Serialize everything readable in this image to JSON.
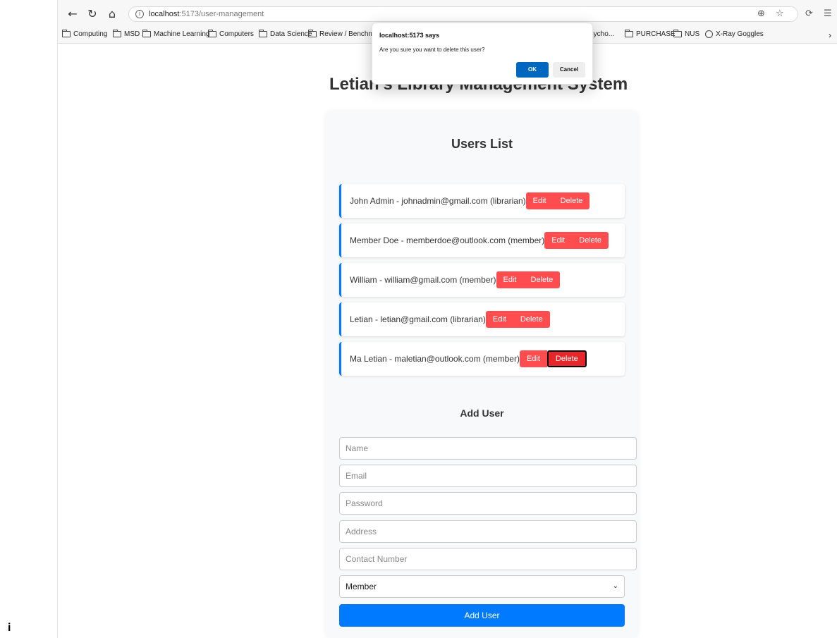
{
  "browser": {
    "url_host": "localhost",
    "url_path": ":5173/user-management",
    "bookmarks": [
      {
        "label": "Computing",
        "icon": "folder-icon"
      },
      {
        "label": "MSD",
        "icon": "folder-icon"
      },
      {
        "label": "Machine Learning",
        "icon": "folder-icon"
      },
      {
        "label": "Computers",
        "icon": "folder-icon"
      },
      {
        "label": "Data Science",
        "icon": "folder-icon"
      },
      {
        "label": "Review / Benchmar",
        "icon": "folder-icon"
      },
      {
        "label": "Psycho...",
        "icon": "folder-icon"
      },
      {
        "label": "PURCHASE",
        "icon": "folder-icon"
      },
      {
        "label": "NUS",
        "icon": "folder-icon"
      },
      {
        "label": "X-Ray Goggles",
        "icon": "globe-icon"
      }
    ]
  },
  "stray_char": "i",
  "page": {
    "title": "Letian's Library Management System",
    "users_title": "Users List",
    "users": [
      {
        "text": "John Admin - johnadmin@gmail.com (librarian)",
        "edit": "Edit",
        "delete": "Delete"
      },
      {
        "text": "Member Doe - memberdoe@outlook.com (member)",
        "edit": "Edit",
        "delete": "Delete"
      },
      {
        "text": "William - william@gmail.com (member)",
        "edit": "Edit",
        "delete": "Delete"
      },
      {
        "text": "Letian - letian@gmail.com (librarian)",
        "edit": "Edit",
        "delete": "Delete"
      },
      {
        "text": "Ma Letian - maletian@outlook.com (member)",
        "edit": "Edit",
        "delete": "Delete"
      }
    ],
    "add_title": "Add User",
    "form": {
      "name_placeholder": "Name",
      "email_placeholder": "Email",
      "password_placeholder": "Password",
      "address_placeholder": "Address",
      "contact_placeholder": "Contact Number",
      "role_selected": "Member",
      "submit_label": "Add User"
    }
  },
  "dialog": {
    "title": "localhost:5173 says",
    "message": "Are you sure you want to delete this user?",
    "ok": "OK",
    "cancel": "Cancel"
  },
  "colors": {
    "accent": "#007bff",
    "danger": "#ff4d4f",
    "dialog_ok": "#0067c0"
  }
}
